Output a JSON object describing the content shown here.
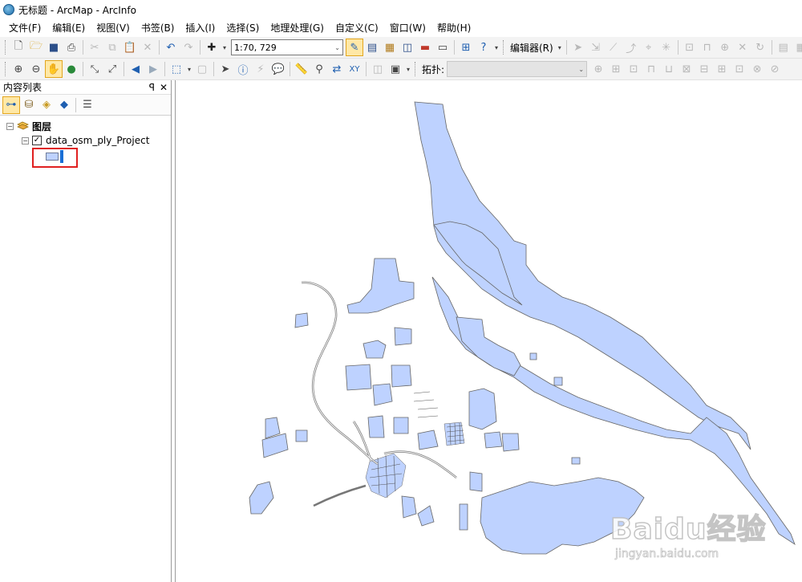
{
  "window": {
    "title": "无标题 - ArcMap - ArcInfo"
  },
  "menubar": {
    "items": [
      "文件(F)",
      "编辑(E)",
      "视图(V)",
      "书签(B)",
      "插入(I)",
      "选择(S)",
      "地理处理(G)",
      "自定义(C)",
      "窗口(W)",
      "帮助(H)"
    ]
  },
  "toolbar": {
    "scale": "1:70, 729",
    "editor_label": "编辑器(R)",
    "topology_label": "拓扑:"
  },
  "toc": {
    "title": "内容列表",
    "pin_glyph": "ꟼ",
    "close_glyph": "✕",
    "root_label": "图层",
    "layer_name": "data_osm_ply_Project",
    "layer_checked": true,
    "symbol_fill": "#bed2ff",
    "symbol_outline": "#6f7b99"
  },
  "map": {
    "polygon_fill": "#bed2ff",
    "polygon_outline": "#666666"
  },
  "watermark": {
    "text": "Baidu经验",
    "url": "jingyan.baidu.com"
  }
}
